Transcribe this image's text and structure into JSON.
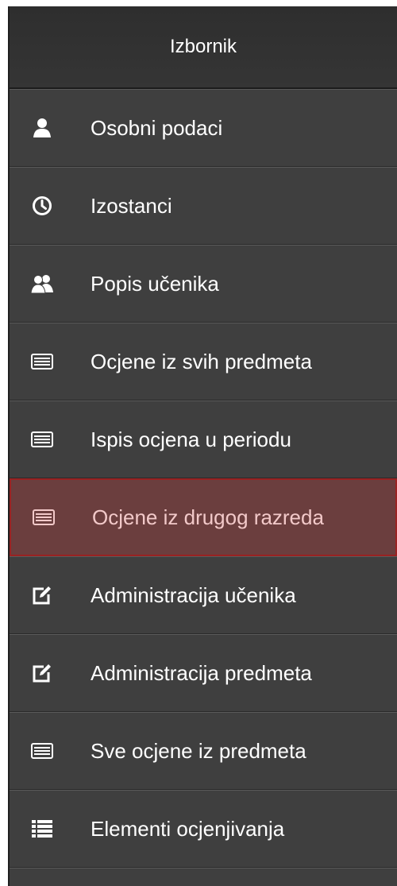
{
  "menu": {
    "title": "Izbornik",
    "items": [
      {
        "label": "Osobni podaci",
        "icon": "user-icon"
      },
      {
        "label": "Izostanci",
        "icon": "clock-icon"
      },
      {
        "label": "Popis učenika",
        "icon": "users-icon"
      },
      {
        "label": "Ocjene iz svih predmeta",
        "icon": "list-card-icon"
      },
      {
        "label": "Ispis ocjena u periodu",
        "icon": "list-card-icon"
      },
      {
        "label": "Ocjene iz drugog razreda",
        "icon": "list-card-icon",
        "active": true
      },
      {
        "label": "Administracija učenika",
        "icon": "edit-icon"
      },
      {
        "label": "Administracija predmeta",
        "icon": "edit-icon"
      },
      {
        "label": "Sve ocjene iz predmeta",
        "icon": "list-card-icon"
      },
      {
        "label": "Elementi ocjenjivanja",
        "icon": "list-icon"
      }
    ]
  },
  "colors": {
    "sidebar_bg": "#3f3f3f",
    "header_bg": "#2e2e2e",
    "active_bg": "#6b3e3e",
    "active_border": "#9a2222",
    "text": "#ffffff"
  }
}
